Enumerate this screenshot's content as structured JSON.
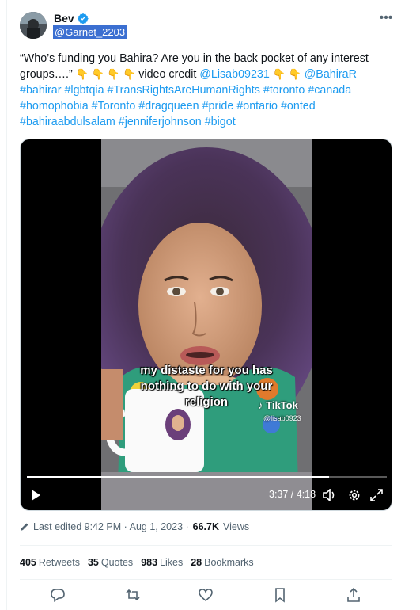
{
  "author": {
    "display_name": "Bev",
    "handle": "@Garnet_2203"
  },
  "tweet": {
    "text_main": "“Who’s funding you Bahira? Are you in the back pocket of any interest groups….” ",
    "text_credit": " video credit ",
    "mention_1": "@Lisab09231",
    "mention_2": "@BahiraR",
    "hashtags": [
      "#bahirar",
      "#lgbtqia",
      "#TransRightsAreHumanRights",
      "#toronto",
      "#canada",
      "#homophobia",
      "#Toronto",
      "#dragqueen",
      "#pride",
      "#ontario",
      "#onted",
      "#bahiraabdulsalam",
      "#jenniferjohnson",
      "#bigot"
    ]
  },
  "video": {
    "caption_line1": "my distaste for you has",
    "caption_line2": "nothing to do with your",
    "caption_line3": "religion",
    "tiktok_label": "TikTok",
    "tiktok_handle": "@lisab0923",
    "time": "3:37 / 4:18",
    "progress": 0.84
  },
  "meta": {
    "edited_label": "Last edited 9:42 PM · Aug 1, 2023 · ",
    "views_count": "66.7K",
    "views_label": "Views"
  },
  "stats": {
    "retweets_count": "405",
    "retweets_label": "Retweets",
    "quotes_count": "35",
    "quotes_label": "Quotes",
    "likes_count": "983",
    "likes_label": "Likes",
    "bookmarks_count": "28",
    "bookmarks_label": "Bookmarks"
  },
  "icons": {
    "reply": "reply-icon",
    "retweet": "retweet-icon",
    "like": "like-icon",
    "bookmark": "bookmark-icon",
    "share": "share-icon"
  },
  "colors": {
    "link": "#1d9bf0",
    "verified": "#1d9bf0",
    "muted": "#536471"
  }
}
